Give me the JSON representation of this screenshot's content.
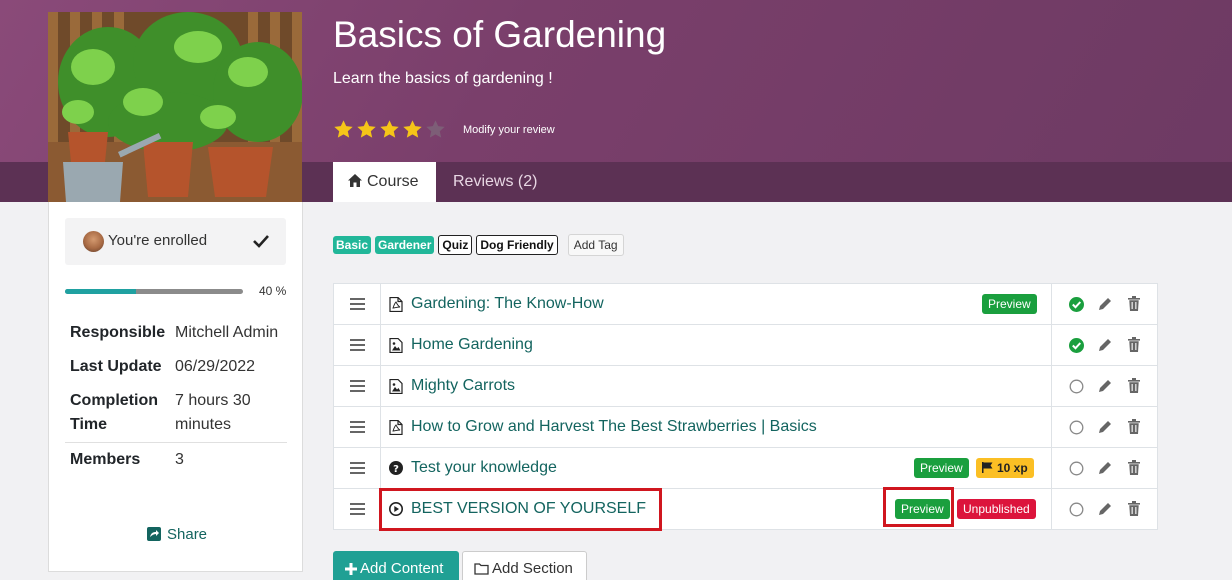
{
  "course": {
    "title": "Basics of Gardening",
    "subtitle": "Learn the basics of gardening !",
    "rating": 4,
    "rating_max": 5,
    "modify_review": "Modify your review"
  },
  "tabs": [
    {
      "label": "Course",
      "icon": "home-icon",
      "active": true
    },
    {
      "label": "Reviews (2)",
      "active": false
    }
  ],
  "sidebar": {
    "enrolled_text": "You're enrolled",
    "progress_value": 0.4,
    "progress_text": "40 %",
    "info": [
      {
        "label": "Responsible",
        "value": "Mitchell Admin"
      },
      {
        "label": "Last Update",
        "value": "06/29/2022"
      },
      {
        "label": "Completion Time",
        "value": "7 hours 30 minutes"
      },
      {
        "label": "Members",
        "value": "3"
      }
    ],
    "share_label": "Share"
  },
  "tags": [
    {
      "label": "Basic",
      "style": "green"
    },
    {
      "label": "Gardener",
      "style": "green"
    },
    {
      "label": "Quiz",
      "style": "white"
    },
    {
      "label": "Dog Friendly",
      "style": "white"
    }
  ],
  "add_tag_label": "Add Tag",
  "contents": [
    {
      "title": "Gardening: The Know-How",
      "icon": "pdf-icon",
      "badges": [
        "Preview"
      ],
      "completed": true
    },
    {
      "title": "Home Gardening",
      "icon": "image-icon",
      "badges": [],
      "completed": true
    },
    {
      "title": "Mighty Carrots",
      "icon": "image-icon",
      "badges": [],
      "completed": false
    },
    {
      "title": "How to Grow and Harvest The Best Strawberries | Basics",
      "icon": "pdf-icon",
      "badges": [],
      "completed": false
    },
    {
      "title": "Test your knowledge",
      "icon": "question-icon",
      "badges": [
        "Preview"
      ],
      "xp": "10 xp",
      "completed": false
    },
    {
      "title": "BEST VERSION OF YOURSELF",
      "icon": "play-icon",
      "badges": [
        "Preview",
        "Unpublished"
      ],
      "completed": false
    }
  ],
  "buttons": {
    "add_content": "Add Content",
    "add_section": "Add Section"
  },
  "colors": {
    "hero": "#7a3f6b",
    "link": "#13645f",
    "accent": "#20a094",
    "star": "#f5c518",
    "highlight": "#d0161f"
  }
}
